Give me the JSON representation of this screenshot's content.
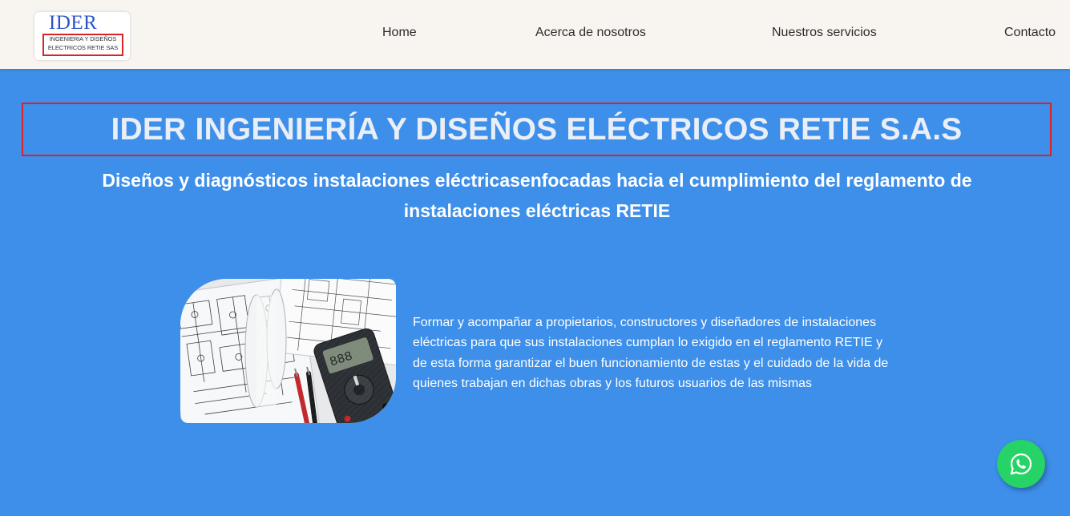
{
  "header": {
    "logo": {
      "wordmark": "IDER",
      "line1": "INGENIERIA Y DISEÑOS",
      "line2": "ELECTRICOS RETIE SAS"
    },
    "nav": [
      {
        "label": "Home"
      },
      {
        "label": "Acerca de nosotros"
      },
      {
        "label": "Nuestros servicios"
      },
      {
        "label": "Contacto"
      }
    ]
  },
  "hero": {
    "title": "IDER INGENIERÍA Y DISEÑOS ELÉCTRICOS RETIE S.A.S",
    "subtitle": "Diseños y diagnósticos instalaciones eléctricasenfocadas hacia el cumplimiento del reglamento de instalaciones eléctricas RETIE"
  },
  "feature": {
    "image_alt": "electrical-blueprints-with-multimeter",
    "text": "Formar y acompañar a propietarios, constructores y diseñadores de instalaciones eléctricas para que sus instalaciones cumplan lo exigido en el reglamento RETIE y de esta forma garantizar el buen funcionamiento de estas y el cuidado de la vida de quienes trabajan en dichas obras y los futuros usuarios de las mismas"
  },
  "whatsapp": {
    "icon": "whatsapp-icon"
  },
  "colors": {
    "background": "#3d8fe9",
    "header": "#f8f5f1",
    "accent_red": "#d8232a",
    "whatsapp_green": "#25d366",
    "logo_blue": "#2b56c2"
  }
}
